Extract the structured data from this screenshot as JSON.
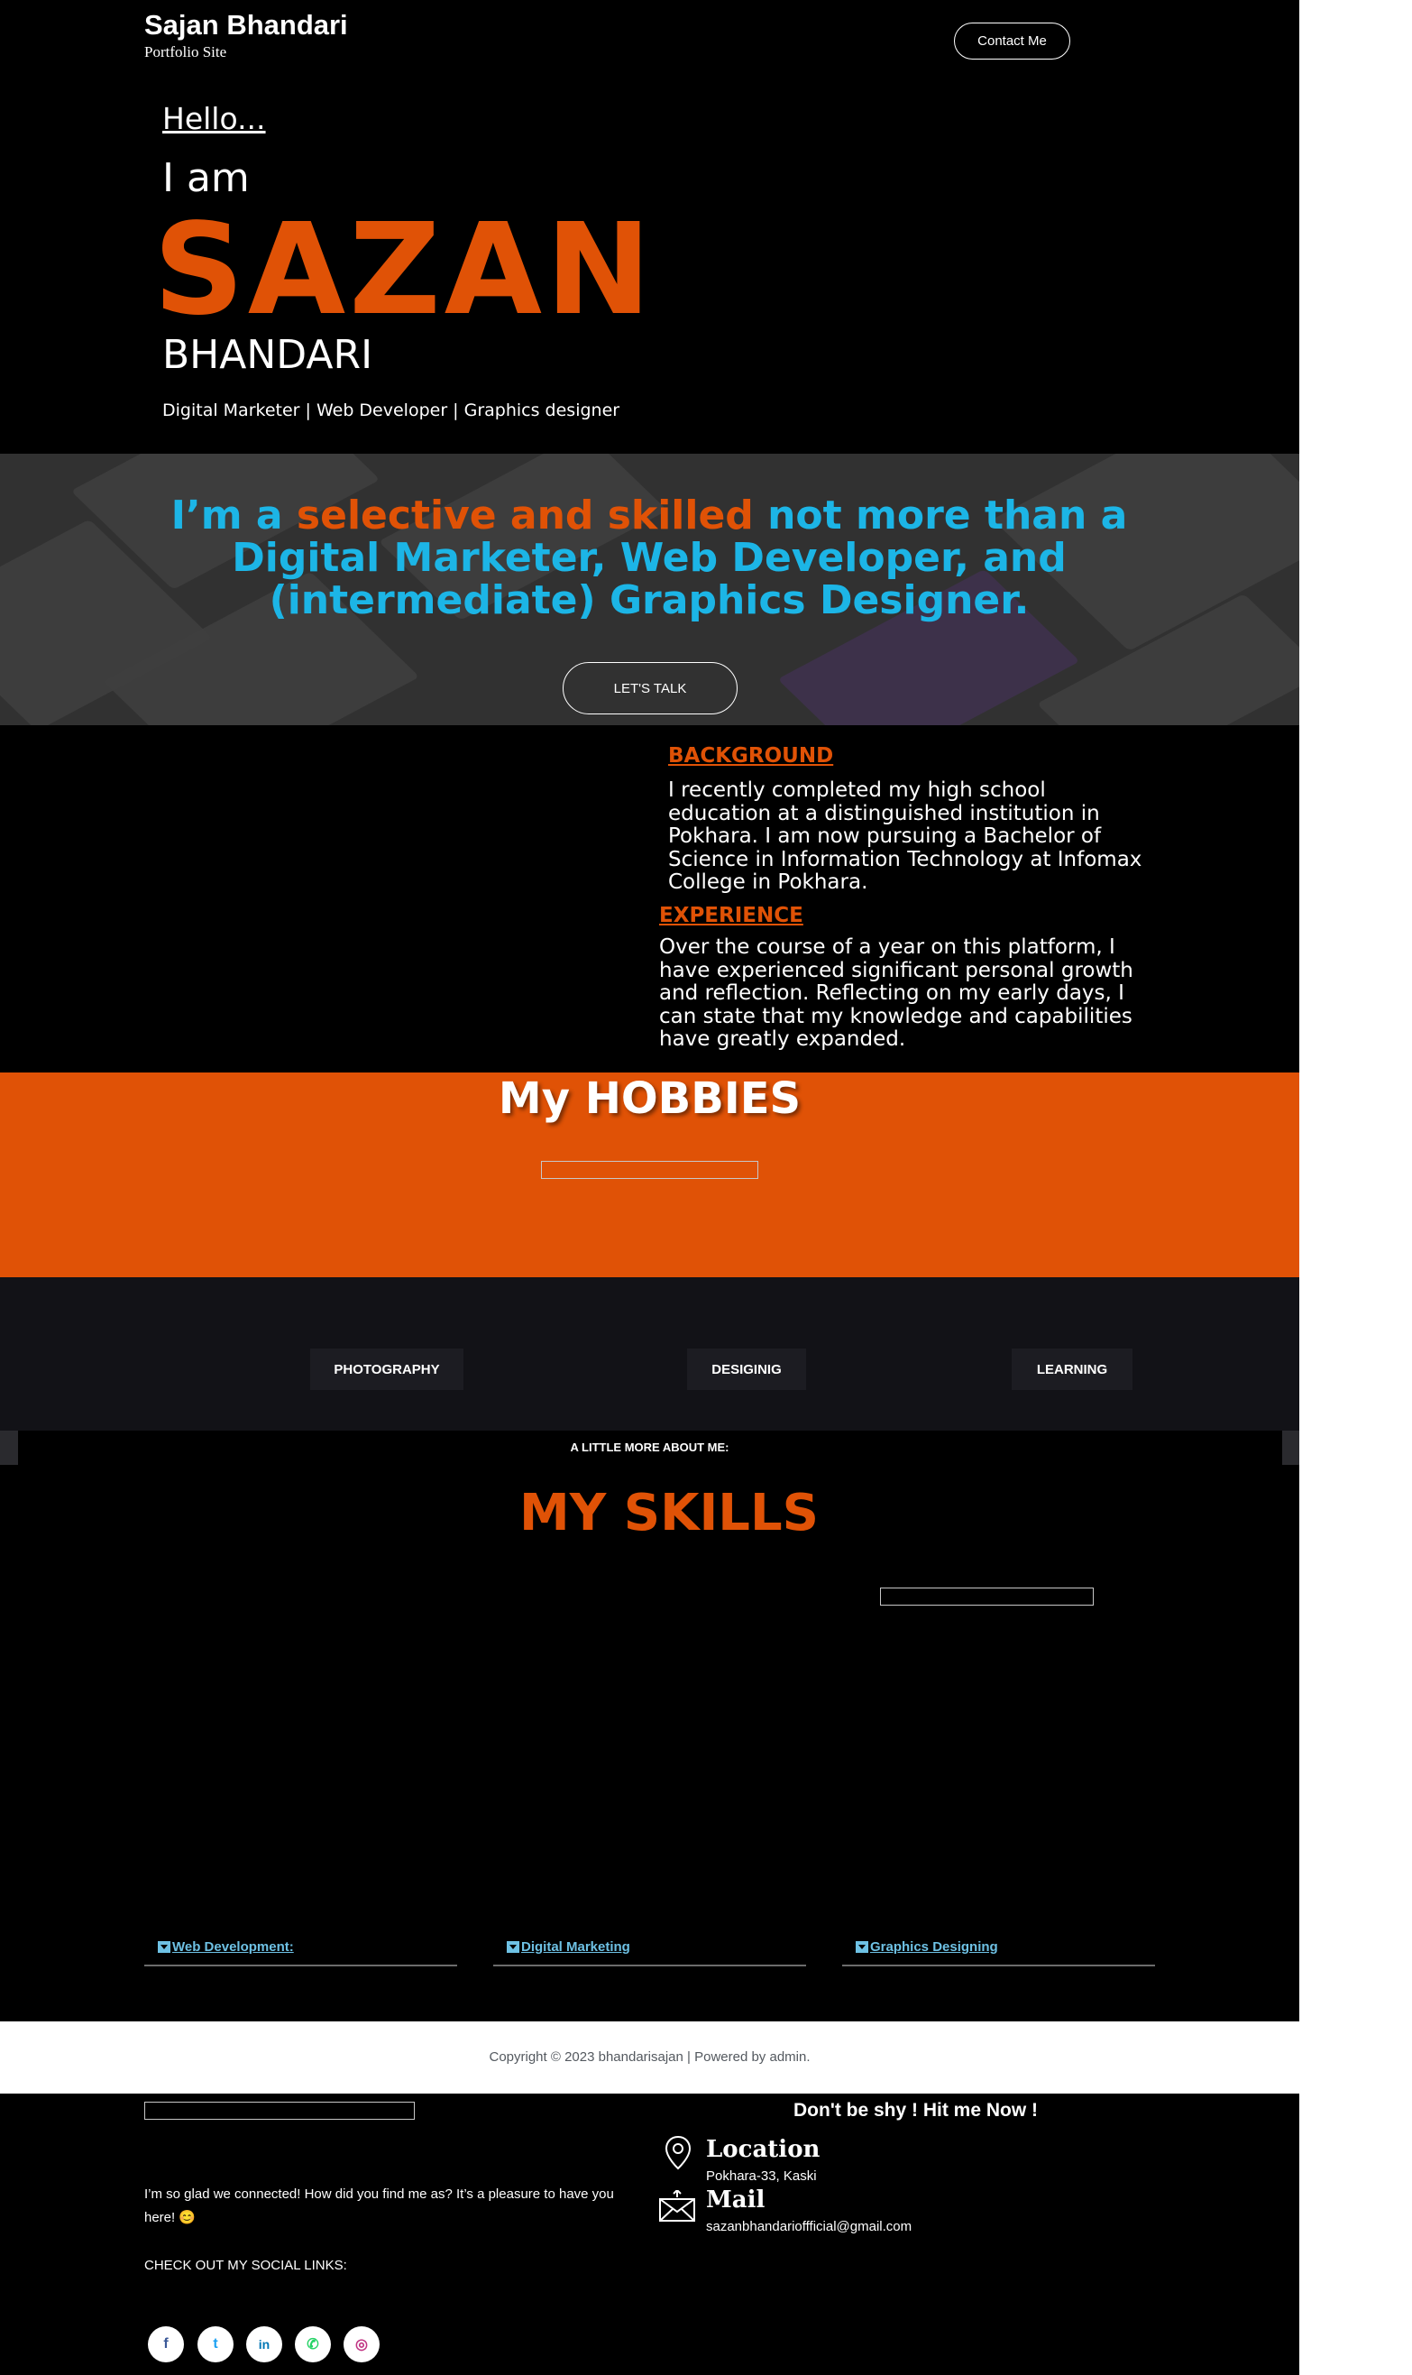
{
  "header": {
    "site_title": "Sajan Bhandari",
    "tagline": "Portfolio Site",
    "contact_label": "Contact Me"
  },
  "hero": {
    "greeting": "Hello...",
    "i_am": "I am",
    "first_name": "SAZAN",
    "last_name": "BHANDARI",
    "roles": "Digital Marketer | Web Developer | Graphics designer"
  },
  "banner": {
    "text_part1": "I’m a ",
    "text_highlight": "selective and skilled",
    "text_part2": " not more than a Digital Marketer, Web Developer, and (intermediate) Graphics Designer.",
    "cta_label": "LET'S TALK",
    "accent_color": "#1cb5e6",
    "highlight_color": "#e05206"
  },
  "about": {
    "background_title": "BACKGROUND",
    "background_text": "I recently completed my high school education at a distinguished institution in Pokhara. I am now pursuing a Bachelor of Science in Information Technology at Infomax College in Pokhara.",
    "experience_title": "EXPERIENCE",
    "experience_text": "Over the course of a year on this platform, I have experienced significant personal growth and reflection. Reflecting on my early days, I can state that my knowledge and capabilities have greatly expanded."
  },
  "hobbies": {
    "title": "My HOBBIES",
    "items": [
      "PHOTOGRAPHY",
      "DESIGIΝIG",
      "LEARNING"
    ]
  },
  "skills": {
    "eyebrow": "A LITTLE MORE ABOUT ME:",
    "title": "MY SKILLS",
    "tabs": [
      "Web Development:",
      "Digital Marketing",
      "Graphics Designing"
    ]
  },
  "copyright": "Copyright © 2023 bhandarisajan | Powered by admin.",
  "footer": {
    "message": "I’m so glad we connected! How did you find me as? It’s a pleasure to have you here! 😊",
    "social_heading": "CHECK OUT MY SOCIAL LINKS:",
    "social": [
      {
        "name": "facebook-icon",
        "glyph": "f",
        "color": "#3b5998"
      },
      {
        "name": "twitter-icon",
        "glyph": "t",
        "color": "#1da1f2"
      },
      {
        "name": "linkedin-icon",
        "glyph": "in",
        "color": "#0077b5"
      },
      {
        "name": "whatsapp-icon",
        "glyph": "✆",
        "color": "#25d366"
      },
      {
        "name": "instagram-icon",
        "glyph": "◎",
        "color": "#c13584"
      }
    ],
    "cta_heading": "Don't be shy ! Hit me Now !",
    "location_label": "Location",
    "location_value": "Pokhara-33, Kaski",
    "mail_label": "Mail",
    "mail_value": "sazanbhandarioffficial@gmail.com"
  }
}
